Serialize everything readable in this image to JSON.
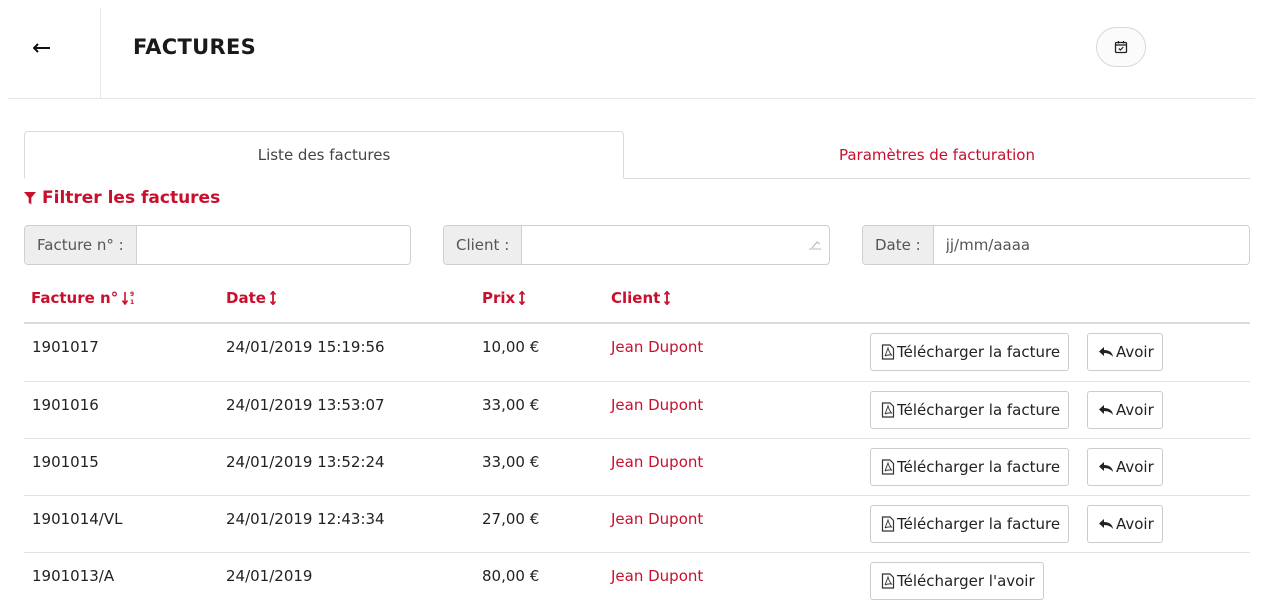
{
  "header": {
    "title": "FACTURES",
    "back_icon": "arrow-left-icon",
    "calendar_icon": "calendar-check-icon"
  },
  "tabs": [
    {
      "label": "Liste des factures",
      "active": true
    },
    {
      "label": "Paramètres de facturation",
      "active": false
    }
  ],
  "filter": {
    "title": "Filtrer les factures",
    "icon": "funnel-icon",
    "invoice_label": "Facture n° :",
    "invoice_value": "",
    "client_label": "Client :",
    "client_value": "",
    "date_label": "Date :",
    "date_placeholder": "jj/mm/aaaa"
  },
  "table": {
    "columns": [
      "Facture n°",
      "Date",
      "Prix",
      "Client"
    ],
    "rows": [
      {
        "number": "1901017",
        "date": "24/01/2019 15:19:56",
        "price": "10,00 €",
        "client": "Jean Dupont",
        "download_label": "Télécharger la facture",
        "credit_label": "Avoir"
      },
      {
        "number": "1901016",
        "date": "24/01/2019 13:53:07",
        "price": "33,00 €",
        "client": "Jean Dupont",
        "download_label": "Télécharger la facture",
        "credit_label": "Avoir"
      },
      {
        "number": "1901015",
        "date": "24/01/2019 13:52:24",
        "price": "33,00 €",
        "client": "Jean Dupont",
        "download_label": "Télécharger la facture",
        "credit_label": "Avoir"
      },
      {
        "number": "1901014/VL",
        "date": "24/01/2019 12:43:34",
        "price": "27,00 €",
        "client": "Jean Dupont",
        "download_label": "Télécharger la facture",
        "credit_label": "Avoir"
      },
      {
        "number": "1901013/A",
        "date": "24/01/2019",
        "price": "80,00 €",
        "client": "Jean Dupont",
        "download_label": "Télécharger l'avoir",
        "credit_label": null
      }
    ]
  },
  "colors": {
    "accent": "#c8102e",
    "border": "#dcdcdc",
    "addon_bg": "#eeeeee"
  }
}
